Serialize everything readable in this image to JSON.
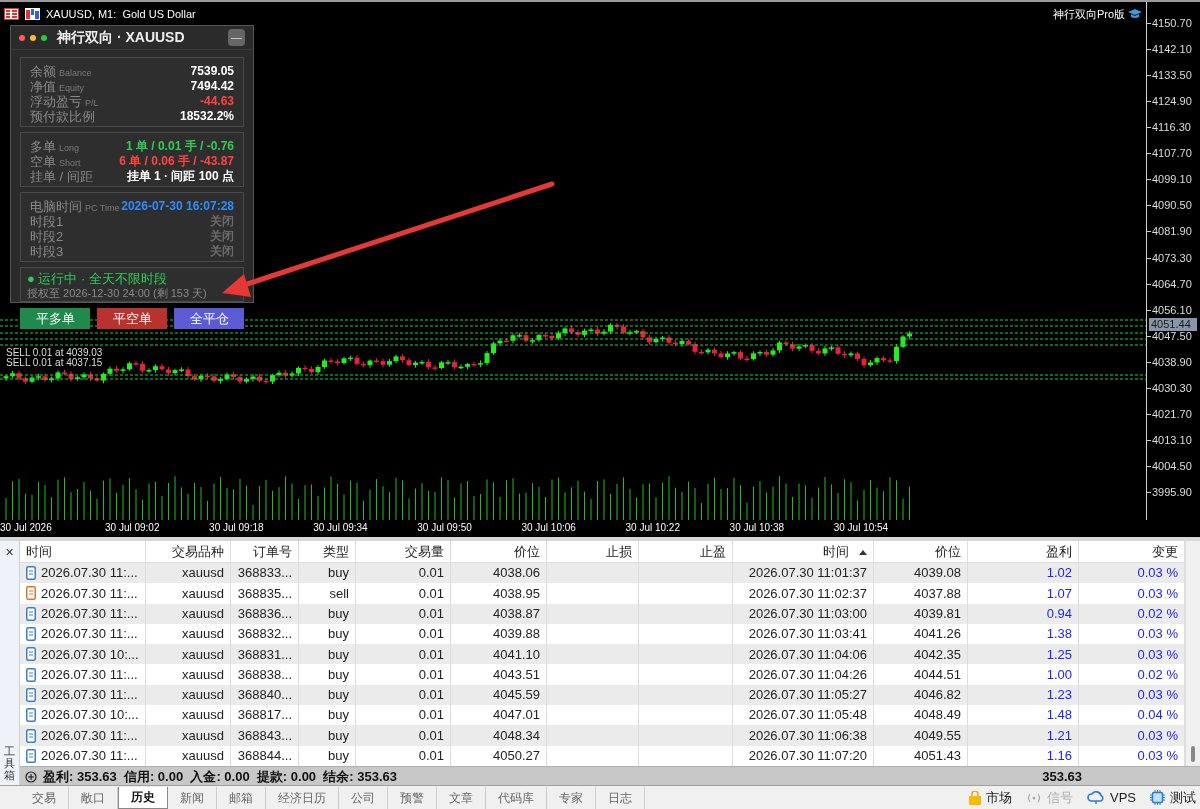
{
  "chart": {
    "title": "XAUUSD, M1:  Gold US Dollar",
    "ea_name": "神行双向Pro版",
    "price_ticks": [
      "4150.70",
      "4142.10",
      "4133.50",
      "4124.90",
      "4116.30",
      "4107.70",
      "4099.10",
      "4090.50",
      "4081.90",
      "4073.30",
      "4064.70",
      "4056.10",
      "4047.50",
      "4038.90",
      "4030.30",
      "4021.70",
      "4013.10",
      "4004.50",
      "3995.90"
    ],
    "current_price": "4051.44",
    "time_labels": [
      "30 Jul 2026",
      "30 Jul 09:02",
      "30 Jul 09:18",
      "30 Jul 09:34",
      "30 Jul 09:50",
      "30 Jul 10:06",
      "30 Jul 10:22",
      "30 Jul 10:38",
      "30 Jul 10:54"
    ],
    "order_labels": [
      "SELL 0.01 at 4039.03",
      "SELL 0.01 at 4037.15"
    ]
  },
  "panel": {
    "title": "神行双向 · XAUUSD",
    "minimize": "—",
    "sections": [
      {
        "rows": [
          {
            "label": "余额",
            "sub": "Balance",
            "value": "7539.05",
            "color": "#ffffff"
          },
          {
            "label": "净值",
            "sub": "Equity",
            "value": "7494.42",
            "color": "#ffffff"
          },
          {
            "label": "浮动盈亏",
            "sub": "P/L",
            "value": "-44.63",
            "color": "#ff4444"
          },
          {
            "label": "预付款比例",
            "value": "18532.2%",
            "color": "#ffffff"
          }
        ]
      },
      {
        "rows": [
          {
            "label": "多单",
            "sub": "Long",
            "value": "1 单 / 0.01 手 / -0.76",
            "color": "#33cc55"
          },
          {
            "label": "空单",
            "sub": "Short",
            "value": "6 单 / 0.06 手 / -43.87",
            "color": "#ff4444"
          },
          {
            "label": "挂单 / 间距",
            "value": "挂单 1 · 间距 100 点",
            "color": "#ffffff"
          }
        ]
      },
      {
        "rows": [
          {
            "label": "电脑时间",
            "sub": "PC Time",
            "value": "2026-07-30 16:07:28",
            "color": "#2f8cff"
          },
          {
            "label": "时段1",
            "value": "关闭",
            "color": "#6a6a6a"
          },
          {
            "label": "时段2",
            "value": "关闭",
            "color": "#6a6a6a"
          },
          {
            "label": "时段3",
            "value": "关闭",
            "color": "#6a6a6a"
          }
        ]
      }
    ],
    "status": "● 运行中 · 全天不限时段",
    "license": "授权至 2026-12-30 24:00 (剩 153 天)"
  },
  "buttons": [
    {
      "label": "平多单",
      "color": "#1f8a4c"
    },
    {
      "label": "平空单",
      "color": "#b8322e"
    },
    {
      "label": "全平仓",
      "color": "#5b5bd6"
    }
  ],
  "table": {
    "columns": [
      {
        "label": "时间",
        "sorted": false
      },
      {
        "label": "交易品种",
        "sorted": false
      },
      {
        "label": "订单号",
        "sorted": false
      },
      {
        "label": "类型",
        "sorted": false
      },
      {
        "label": "交易量",
        "sorted": false
      },
      {
        "label": "价位",
        "sorted": false
      },
      {
        "label": "止损",
        "sorted": false
      },
      {
        "label": "止盈",
        "sorted": false
      },
      {
        "label": "时间",
        "sorted": true
      },
      {
        "label": "价位",
        "sorted": false
      },
      {
        "label": "盈利",
        "sorted": false
      },
      {
        "label": "变更",
        "sorted": false
      }
    ],
    "rows": [
      {
        "kind": "buy",
        "time": "2026.07.30 11:...",
        "symbol": "xauusd",
        "ticket": "368833...",
        "type": "buy",
        "volume": "0.01",
        "price": "4038.06",
        "close_time": "2026.07.30 11:01:37",
        "close_price": "4039.08",
        "profit": "1.02",
        "change": "0.03 %"
      },
      {
        "kind": "sell",
        "time": "2026.07.30 11:...",
        "symbol": "xauusd",
        "ticket": "368835...",
        "type": "sell",
        "volume": "0.01",
        "price": "4038.95",
        "close_time": "2026.07.30 11:02:37",
        "close_price": "4037.88",
        "profit": "1.07",
        "change": "0.03 %"
      },
      {
        "kind": "buy",
        "time": "2026.07.30 11:...",
        "symbol": "xauusd",
        "ticket": "368836...",
        "type": "buy",
        "volume": "0.01",
        "price": "4038.87",
        "close_time": "2026.07.30 11:03:00",
        "close_price": "4039.81",
        "profit": "0.94",
        "change": "0.02 %"
      },
      {
        "kind": "buy",
        "time": "2026.07.30 11:...",
        "symbol": "xauusd",
        "ticket": "368832...",
        "type": "buy",
        "volume": "0.01",
        "price": "4039.88",
        "close_time": "2026.07.30 11:03:41",
        "close_price": "4041.26",
        "profit": "1.38",
        "change": "0.03 %"
      },
      {
        "kind": "buy",
        "time": "2026.07.30 10:...",
        "symbol": "xauusd",
        "ticket": "368831...",
        "type": "buy",
        "volume": "0.01",
        "price": "4041.10",
        "close_time": "2026.07.30 11:04:06",
        "close_price": "4042.35",
        "profit": "1.25",
        "change": "0.03 %"
      },
      {
        "kind": "buy",
        "time": "2026.07.30 11:...",
        "symbol": "xauusd",
        "ticket": "368838...",
        "type": "buy",
        "volume": "0.01",
        "price": "4043.51",
        "close_time": "2026.07.30 11:04:26",
        "close_price": "4044.51",
        "profit": "1.00",
        "change": "0.02 %"
      },
      {
        "kind": "buy",
        "time": "2026.07.30 11:...",
        "symbol": "xauusd",
        "ticket": "368840...",
        "type": "buy",
        "volume": "0.01",
        "price": "4045.59",
        "close_time": "2026.07.30 11:05:27",
        "close_price": "4046.82",
        "profit": "1.23",
        "change": "0.03 %"
      },
      {
        "kind": "buy",
        "time": "2026.07.30 10:...",
        "symbol": "xauusd",
        "ticket": "368817...",
        "type": "buy",
        "volume": "0.01",
        "price": "4047.01",
        "close_time": "2026.07.30 11:05:48",
        "close_price": "4048.49",
        "profit": "1.48",
        "change": "0.04 %"
      },
      {
        "kind": "buy",
        "time": "2026.07.30 11:...",
        "symbol": "xauusd",
        "ticket": "368843...",
        "type": "buy",
        "volume": "0.01",
        "price": "4048.34",
        "close_time": "2026.07.30 11:06:38",
        "close_price": "4049.55",
        "profit": "1.21",
        "change": "0.03 %"
      },
      {
        "kind": "buy",
        "time": "2026.07.30 11:...",
        "symbol": "xauusd",
        "ticket": "368844...",
        "type": "buy",
        "volume": "0.01",
        "price": "4050.27",
        "close_time": "2026.07.30 11:07:20",
        "close_price": "4051.43",
        "profit": "1.16",
        "change": "0.03 %"
      }
    ],
    "summary": "盈利: 353.63  信用: 0.00  入金: 0.00  提款: 0.00  结余: 353.63",
    "summary_total": "353.63"
  },
  "toolbox": {
    "close": "×",
    "label": "工具箱"
  },
  "tabs": [
    {
      "label": "交易",
      "selected": false
    },
    {
      "label": "敞口",
      "selected": false
    },
    {
      "label": "历史",
      "selected": true
    },
    {
      "label": "新闻",
      "selected": false
    },
    {
      "label": "邮箱",
      "selected": false
    },
    {
      "label": "经济日历",
      "selected": false
    },
    {
      "label": "公司",
      "selected": false
    },
    {
      "label": "预警",
      "selected": false
    },
    {
      "label": "文章",
      "selected": false
    },
    {
      "label": "代码库",
      "selected": false
    },
    {
      "label": "专家",
      "selected": false
    },
    {
      "label": "日志",
      "selected": false
    }
  ],
  "status_items": [
    {
      "kind": "market",
      "label": "市场",
      "disabled": false
    },
    {
      "kind": "signal",
      "label": "信号",
      "disabled": true
    },
    {
      "kind": "vps",
      "label": "VPS",
      "disabled": false
    },
    {
      "kind": "tester",
      "label": "测试",
      "disabled": false
    }
  ]
}
